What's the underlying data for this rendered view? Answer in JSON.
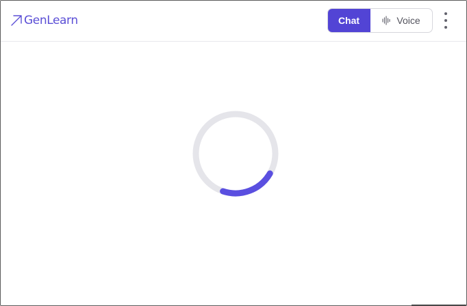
{
  "app": {
    "brand_name": "GenLearn",
    "brand_icon": "arrow-up-right-icon",
    "accent_color": "#5244d5"
  },
  "header": {
    "mode_toggle": {
      "chat_label": "Chat",
      "voice_label": "Voice",
      "voice_icon": "audio-waveform-icon",
      "selected": "Chat"
    },
    "more_icon": "more-vertical-icon"
  },
  "main": {
    "loading_indicator": {
      "type": "spinner",
      "track_color": "#e5e5ea",
      "arc_color": "#5a4fe0"
    }
  }
}
